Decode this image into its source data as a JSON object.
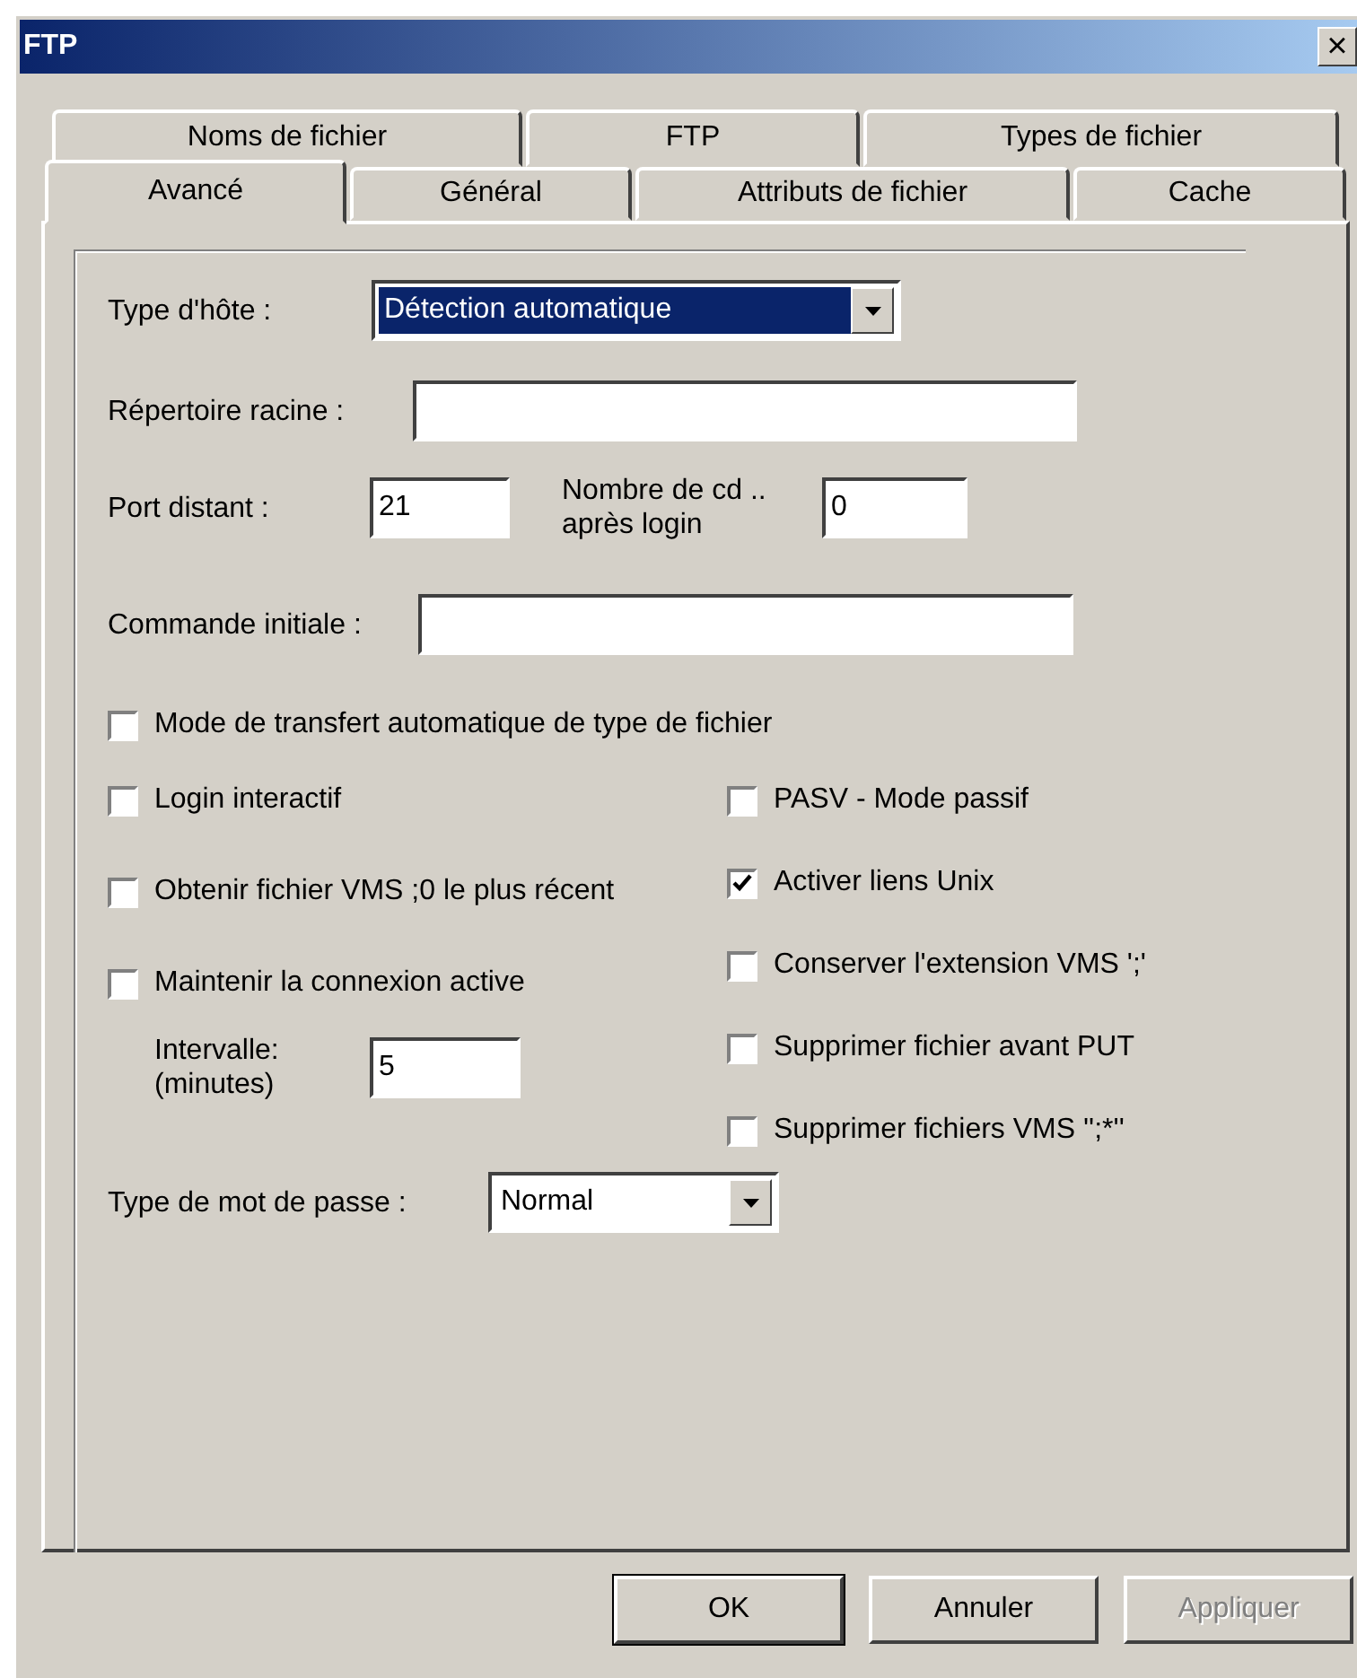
{
  "window": {
    "title": "FTP",
    "close": "×"
  },
  "tab_rows": [
    [
      {
        "label": "Noms de fichier",
        "selected": false
      },
      {
        "label": "FTP",
        "selected": false
      },
      {
        "label": "Types de fichier",
        "selected": false
      }
    ],
    [
      {
        "label": "Avancé",
        "selected": true
      },
      {
        "label": "Général",
        "selected": false
      },
      {
        "label": "Attributs de fichier",
        "selected": false
      },
      {
        "label": "Cache",
        "selected": false
      }
    ]
  ],
  "host_type": {
    "label": "Type d'hôte :",
    "value": "Détection automatique",
    "focused": true
  },
  "root_dir": {
    "label": "Répertoire racine :"
  },
  "remote_port": {
    "label": "Port distant :",
    "value": "21"
  },
  "cd_count": {
    "label": "Nombre de cd .. après login",
    "value": "0"
  },
  "initial_command": {
    "label": "Commande initiale :"
  },
  "auto_transfer": {
    "label": "Mode de transfert automatique de type de fichier",
    "checked": false
  },
  "left_options": [
    {
      "label": "Login interactif",
      "checked": false
    },
    {
      "label": "Obtenir fichier VMS ;0 le plus récent",
      "checked": false
    },
    {
      "label": "Maintenir la connexion active",
      "checked": false
    }
  ],
  "interval": {
    "label": "Intervalle: (minutes)",
    "value": "5"
  },
  "right_options": [
    {
      "label": "PASV - Mode passif",
      "checked": false
    },
    {
      "label": "Activer liens Unix",
      "checked": true
    },
    {
      "label": "Conserver l'extension VMS ';'",
      "checked": false
    },
    {
      "label": "Supprimer fichier avant PUT",
      "checked": false
    },
    {
      "label": "Supprimer fichiers VMS '';*''",
      "checked": false
    }
  ],
  "password_type": {
    "label": "Type de mot de passe :",
    "value": "Normal",
    "focused": false
  },
  "buttons": [
    {
      "label": "OK",
      "default": true,
      "disabled": false
    },
    {
      "label": "Annuler",
      "default": false,
      "disabled": false
    },
    {
      "label": "Appliquer",
      "default": false,
      "disabled": true
    }
  ]
}
